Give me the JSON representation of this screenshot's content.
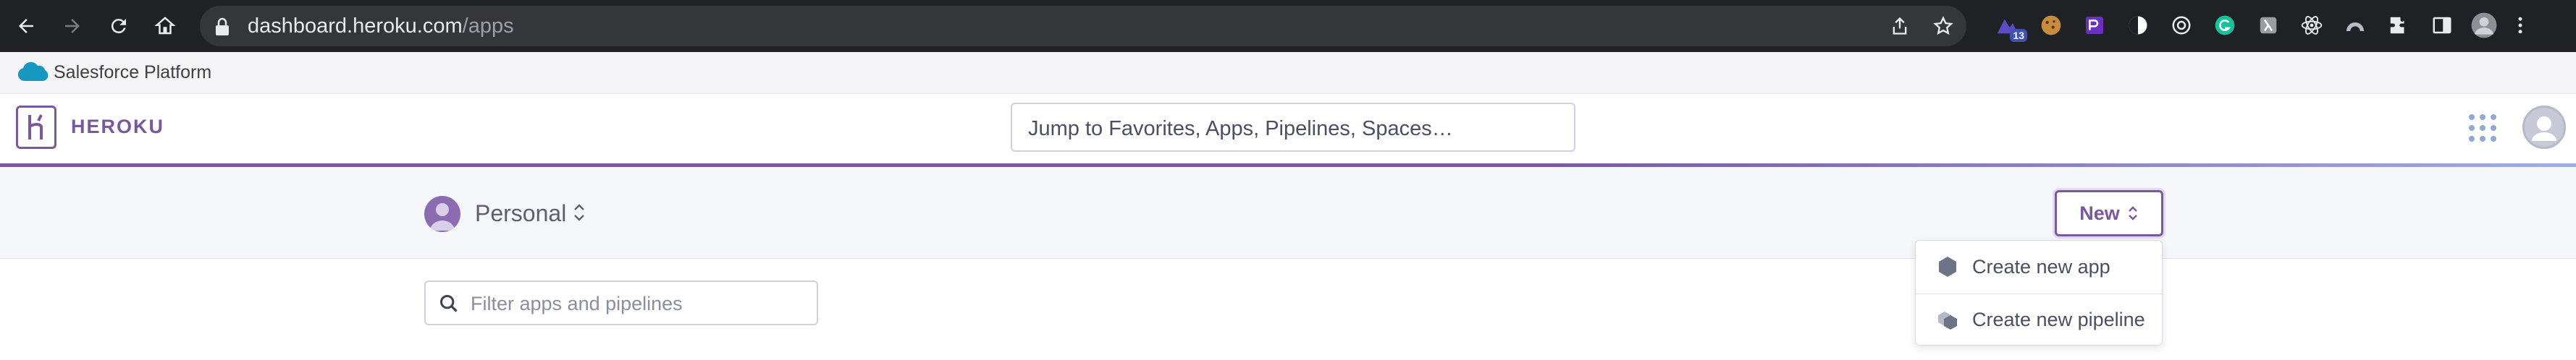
{
  "browser": {
    "url_domain": "dashboard.heroku.com",
    "url_path": "/apps",
    "extension_badge": "13"
  },
  "platform_strip": {
    "label": "Salesforce Platform"
  },
  "header": {
    "logo_text": "HEROKU",
    "search_placeholder": "Jump to Favorites, Apps, Pipelines, Spaces…"
  },
  "account_bar": {
    "account_name": "Personal",
    "new_button_label": "New"
  },
  "new_menu": {
    "items": [
      {
        "label": "Create new app",
        "icon": "hexagon-icon"
      },
      {
        "label": "Create new pipeline",
        "icon": "pipeline-icon"
      }
    ]
  },
  "filter": {
    "placeholder": "Filter apps and pipelines"
  },
  "colors": {
    "brand_purple": "#79589f",
    "browser_dark": "#202124"
  }
}
